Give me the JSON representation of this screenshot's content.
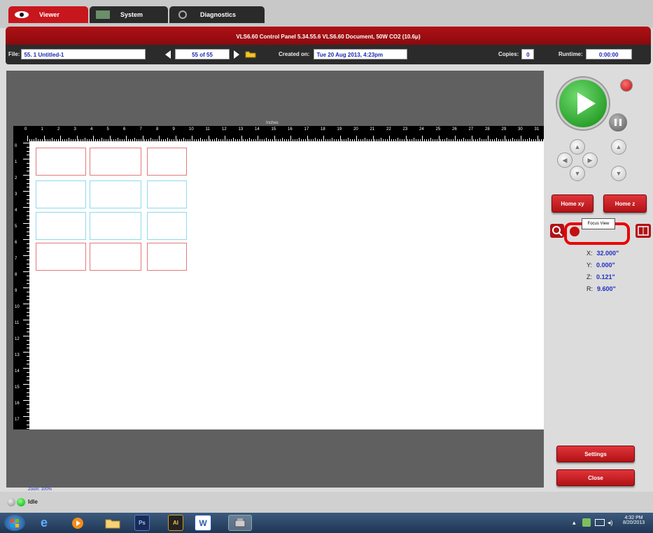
{
  "tabs": [
    {
      "label": "Viewer",
      "icon": "eye-icon",
      "active": true
    },
    {
      "label": "System",
      "icon": "system-icon",
      "active": false
    },
    {
      "label": "Diagnostics",
      "icon": "diagnostics-icon",
      "active": false
    }
  ],
  "title_bar": "VLS6.60  Control Panel  5.34.55.6    VLS6.60 Document, 50W CO2 (10.6μ)",
  "file_bar": {
    "file_label": "File:",
    "file_value": "55. 1 Untitled-1",
    "page_value": "55 of 55",
    "created_label": "Created on:",
    "created_value": "Tue 20 Aug 2013,  4:23pm",
    "copies_label": "Copies:",
    "copies_value": "0",
    "runtime_label": "Runtime:",
    "runtime_value": "0:00:00"
  },
  "ruler": {
    "unit": "Inches",
    "top_ticks": [
      "0",
      "1",
      "2",
      "3",
      "4",
      "5",
      "6",
      "7",
      "8",
      "9",
      "10",
      "11",
      "12",
      "13",
      "14",
      "15",
      "16",
      "17",
      "18",
      "19",
      "20",
      "21",
      "22",
      "23",
      "24",
      "25",
      "26",
      "27",
      "28",
      "29",
      "30",
      "31"
    ],
    "left_ticks": [
      "0",
      "1",
      "2",
      "3",
      "4",
      "5",
      "6",
      "7",
      "8",
      "9",
      "10",
      "11",
      "12",
      "13",
      "14",
      "15",
      "16",
      "17"
    ]
  },
  "controls": {
    "home_xy": "Home xy",
    "home_z": "Home z",
    "focus_tooltip": "Focus View",
    "settings": "Settings",
    "close": "Close"
  },
  "coords": [
    {
      "axis": "X:",
      "value": "32.000\""
    },
    {
      "axis": "Y:",
      "value": "0.000\""
    },
    {
      "axis": "Z:",
      "value": "0.121\""
    },
    {
      "axis": "R:",
      "value": "9.600\""
    }
  ],
  "zoom": "Zoom: 100%",
  "status": "Idle",
  "clock": {
    "time": "4:32 PM",
    "date": "8/20/2013"
  },
  "colors": {
    "accent": "#c8161d",
    "canvas": "#606060",
    "value_text": "#2030c0"
  }
}
